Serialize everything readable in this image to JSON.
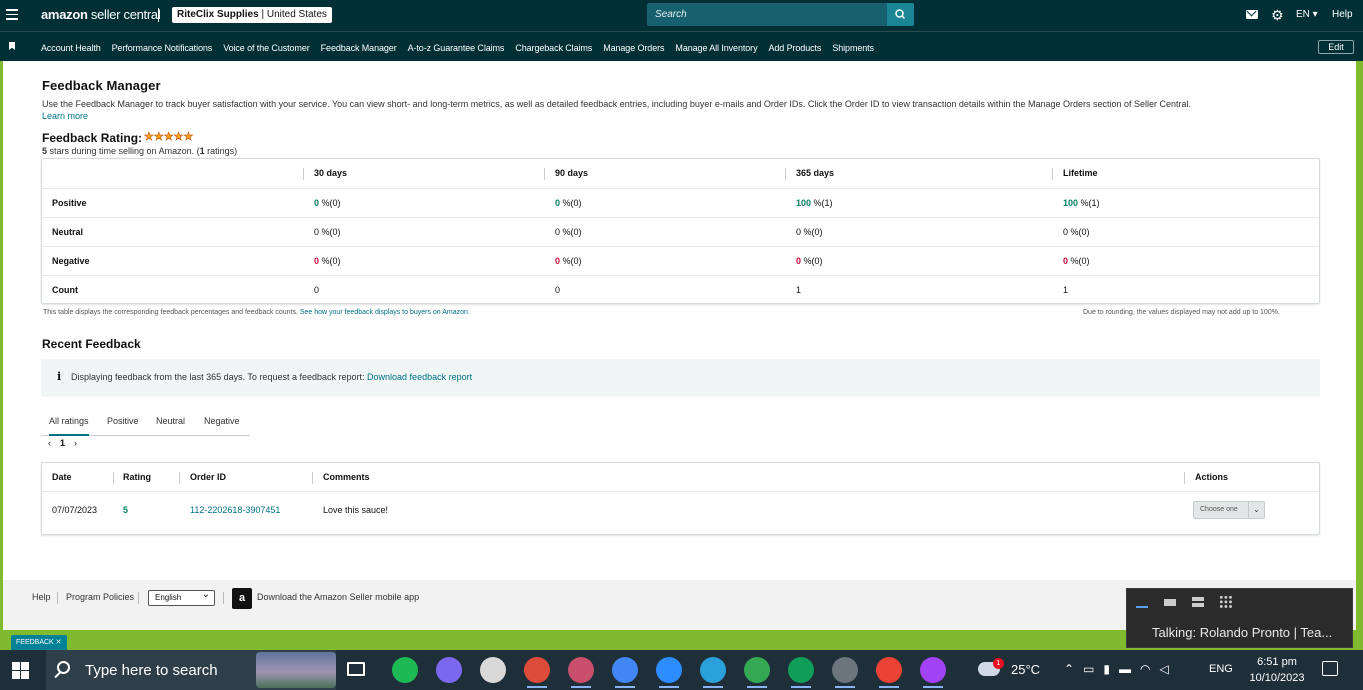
{
  "topbar": {
    "logo_prefix": "amazon",
    "logo_suffix": "seller central",
    "store_name": "RiteClix Supplies",
    "marketplace": "United States",
    "search_placeholder": "Search",
    "lang": "EN ▾",
    "help": "Help"
  },
  "nav": {
    "items": [
      "Account Health",
      "Performance Notifications",
      "Voice of the Customer",
      "Feedback Manager",
      "A-to-z Guarantee Claims",
      "Chargeback Claims",
      "Manage Orders",
      "Manage All Inventory",
      "Add Products",
      "Shipments"
    ],
    "edit": "Edit"
  },
  "page": {
    "title": "Feedback Manager",
    "description": "Use the Feedback Manager to track buyer satisfaction with your service. You can view short- and long-term metrics, as well as detailed feedback entries, including buyer e-mails and Order IDs. Click the Order ID to view transaction details within the Manage Orders section of Seller Central.",
    "learn_more": "Learn more",
    "rating_label": "Feedback Rating:",
    "stars": "★★★★★",
    "rating_stars": 5,
    "rating_sub_bold1": "5",
    "rating_sub_mid": " stars during time selling on Amazon. (",
    "rating_sub_bold2": "1",
    "rating_sub_end": " ratings)"
  },
  "feedback_table": {
    "headers": [
      "30 days",
      "90 days",
      "365 days",
      "Lifetime"
    ],
    "rows": [
      {
        "label": "Positive",
        "cells": [
          {
            "v": "0",
            "s": " %(0)"
          },
          {
            "v": "0",
            "s": " %(0)"
          },
          {
            "v": "100",
            "s": " %(1)"
          },
          {
            "v": "100",
            "s": " %(1)"
          }
        ]
      },
      {
        "label": "Neutral",
        "cells": [
          {
            "v": "0",
            "s": " %(0)"
          },
          {
            "v": "0",
            "s": " %(0)"
          },
          {
            "v": "0",
            "s": " %(0)"
          },
          {
            "v": "0",
            "s": " %(0)"
          }
        ]
      },
      {
        "label": "Negative",
        "cells": [
          {
            "v": "0",
            "s": " %(0)"
          },
          {
            "v": "0",
            "s": " %(0)"
          },
          {
            "v": "0",
            "s": " %(0)"
          },
          {
            "v": "0",
            "s": " %(0)"
          }
        ]
      },
      {
        "label": "Count",
        "cells": [
          {
            "v": "0",
            "s": ""
          },
          {
            "v": "0",
            "s": ""
          },
          {
            "v": "1",
            "s": ""
          },
          {
            "v": "1",
            "s": ""
          }
        ]
      }
    ],
    "note_left": "This table displays the corresponding feedback percentages and feedback counts.",
    "note_left_link": "See how your feedback displays to buyers on Amazon.",
    "note_right": "Due to rounding, the values displayed may not add up to 100%."
  },
  "recent": {
    "title": "Recent Feedback",
    "info": "Displaying feedback from the last 365 days. To request a feedback report:",
    "info_link": "Download feedback report",
    "tabs": [
      "All ratings",
      "Positive",
      "Neutral",
      "Negative"
    ],
    "page_prev": "‹",
    "page_num": "1",
    "page_next": "›",
    "columns": [
      "Date",
      "Rating",
      "Order ID",
      "Comments",
      "Actions"
    ],
    "row": {
      "date": "07/07/2023",
      "rating": "5",
      "order_id": "112-2202618-3907451",
      "comment": "Love this sauce!",
      "action": "Choose one"
    }
  },
  "footer": {
    "help": "Help",
    "policies": "Program Policies",
    "language": "English",
    "app": "Download the Amazon Seller mobile app"
  },
  "feedback_tab": "FEEDBACK ✕",
  "teams": {
    "text": "Talking: Rolando Pronto | Tea..."
  },
  "taskbar": {
    "search": "Type here to search",
    "temp": "25°C",
    "badge": "1",
    "eng": "ENG",
    "time": "6:51 pm",
    "date": "10/10/2023",
    "app_colors": [
      "#1db954",
      "#7b68ee",
      "#d9d9d9",
      "#dd4b39",
      "#c94f6d",
      "#4285f4",
      "#2d8cff",
      "#2aa1da",
      "#34a853",
      "#0f9d58",
      "#6c757d",
      "#ea4335",
      "#a142f4"
    ]
  }
}
